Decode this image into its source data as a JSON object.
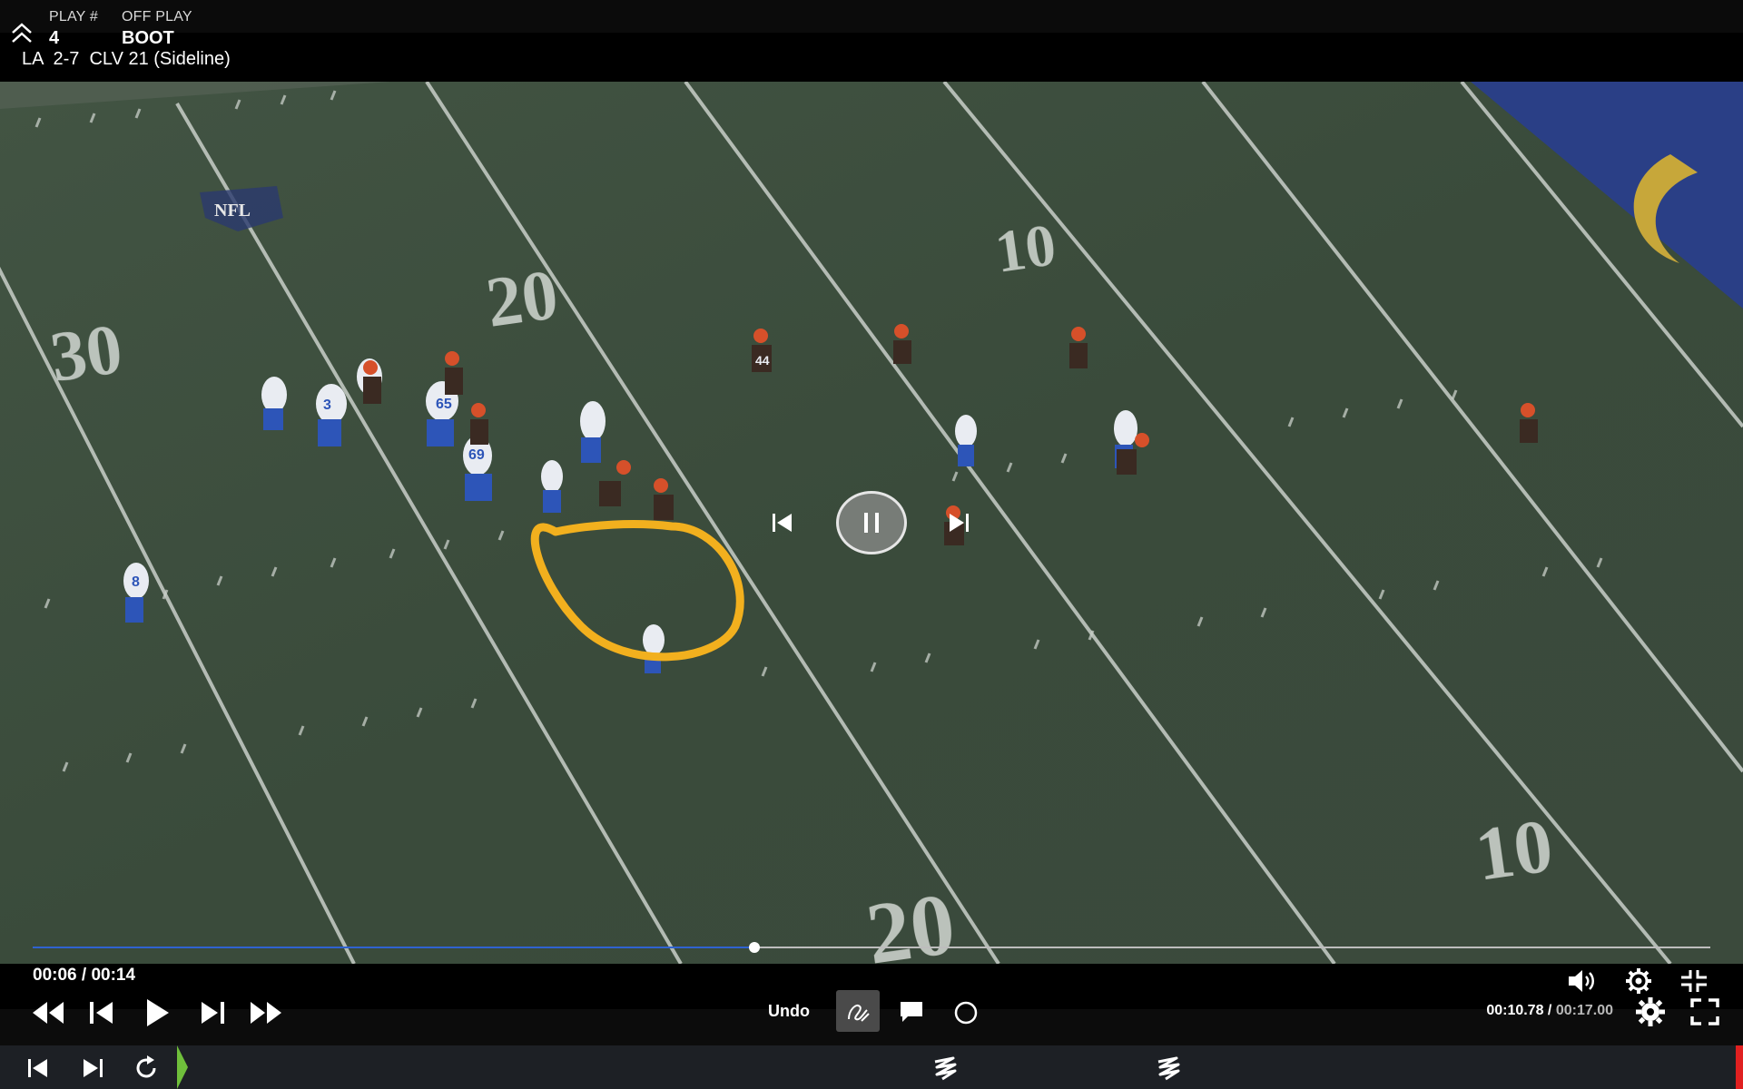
{
  "header": {
    "play_label": "PLAY #",
    "play_value": "4",
    "offplay_label": "OFF PLAY",
    "offplay_value": "BOOT",
    "situation": "LA  2-7  CLV 21 (Sideline)"
  },
  "field": {
    "yard_numbers": [
      "30",
      "20",
      "10",
      "10",
      "20"
    ],
    "logo_text": "NFL",
    "jersey_numbers": [
      "3",
      "65",
      "69",
      "44",
      "8"
    ],
    "annotation_color": "#f2b01e"
  },
  "scrubber": {
    "progress_fraction": 0.43
  },
  "controls": {
    "time_current": "00:06",
    "time_total": "00:14",
    "time_sep": " / ",
    "undo_label": "Undo",
    "clip_time_current": "00:10.78",
    "clip_time_sep": " / ",
    "clip_time_total": "00:17.00"
  },
  "icons": {
    "collapse": "double-chevron-up-icon",
    "rewind": "rewind-icon",
    "step_back": "step-back-icon",
    "play": "play-icon",
    "step_forward": "step-forward-icon",
    "fast_forward": "fast-forward-icon",
    "pen": "freehand-pen-icon",
    "comment": "comment-icon",
    "circle": "circle-tool-icon",
    "volume": "volume-icon",
    "settings": "gear-icon",
    "exit_fullscreen": "exit-fullscreen-icon",
    "fullscreen": "fullscreen-icon"
  },
  "colors": {
    "progress": "#2f63d1",
    "timeline_start": "#6fbf3b",
    "timeline_end": "#e02020",
    "annotation": "#f2b01e"
  }
}
